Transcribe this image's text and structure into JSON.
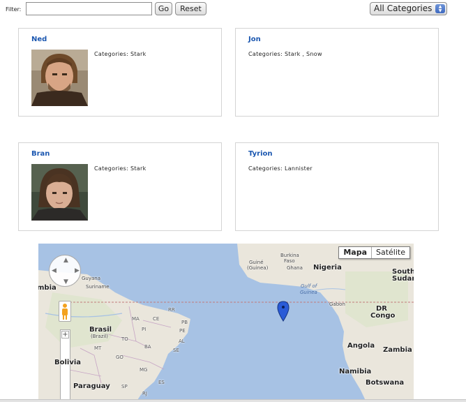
{
  "toolbar": {
    "filter_label": "Filter:",
    "filter_value": "",
    "go_label": "Go",
    "reset_label": "Reset",
    "category_selected": "All Categories"
  },
  "cards": [
    {
      "name": "Ned",
      "categories": "Categories: Stark",
      "has_photo": true
    },
    {
      "name": "Jon",
      "categories": "Categories: Stark , Snow",
      "has_photo": false
    },
    {
      "name": "Bran",
      "categories": "Categories: Stark",
      "has_photo": true
    },
    {
      "name": "Tyrion",
      "categories": "Categories: Lannister",
      "has_photo": false
    }
  ],
  "map": {
    "type_map": "Mapa",
    "type_satellite": "Satélite",
    "labels": {
      "guine": "Guiné",
      "guinea": "(Guinea)",
      "burkina": "Burkina",
      "faso": "Faso",
      "ghana": "Ghana",
      "nigeria": "Nigeria",
      "south": "South",
      "sudan": "Sudan",
      "mbia": "mbia",
      "guyana": "Guyana",
      "suriname": "Suriname",
      "gulf": "Gulf of",
      "guinea_sea": "Guinea",
      "gabon": "Gabon",
      "dr": "DR",
      "congo": "Congo",
      "rr": "RR",
      "ma": "MA",
      "ce": "CE",
      "pb": "PB",
      "pe": "PE",
      "al": "AL",
      "se": "SE",
      "to": "TO",
      "ba": "BA",
      "pi": "PI",
      "brasil": "Brasil",
      "brazil": "(Brazil)",
      "mt": "MT",
      "go": "GO",
      "mg": "MG",
      "es": "ES",
      "sp": "SP",
      "rj": "RJ",
      "bolivia": "Bolivia",
      "paraguay": "Paraguay",
      "angola": "Angola",
      "zambia": "Zambia",
      "namibia": "Namibia",
      "botswana": "Botswana"
    }
  }
}
